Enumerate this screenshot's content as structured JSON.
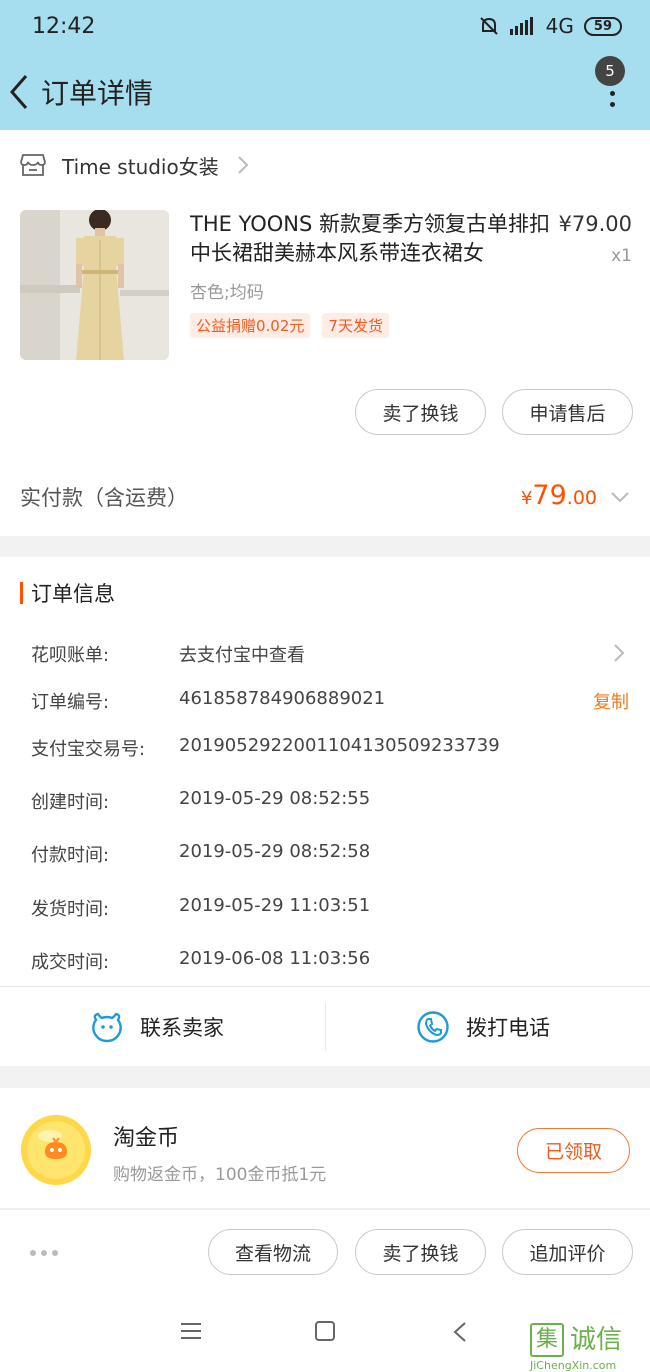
{
  "status_bar": {
    "time": "12:42",
    "network": "4G",
    "battery": "59"
  },
  "header": {
    "title": "订单详情",
    "badge_count": "5"
  },
  "shop": {
    "name": "Time studio女装"
  },
  "product": {
    "title": "THE YOONS 新款夏季方领复古单排扣中长裙甜美赫本风系带连衣裙女",
    "price": "¥79.00",
    "quantity": "x1",
    "sku": "杏色;均码",
    "tags": [
      "公益捐赠0.02元",
      "7天发货"
    ],
    "buttons": {
      "resell": "卖了换钱",
      "after_sale": "申请售后"
    }
  },
  "total": {
    "label": "实付款（含运费）",
    "currency": "¥",
    "integer": "79",
    "decimal": ".00"
  },
  "order_info": {
    "title": "订单信息",
    "rows": [
      {
        "label": "花呗账单:",
        "value": "去支付宝中查看"
      },
      {
        "label": "订单编号:",
        "value": "461858784906889021",
        "action": "复制"
      },
      {
        "label": "支付宝交易号:",
        "value": "2019052922001104130509233739"
      },
      {
        "label": "创建时间:",
        "value": "2019-05-29 08:52:55"
      },
      {
        "label": "付款时间:",
        "value": "2019-05-29 08:52:58"
      },
      {
        "label": "发货时间:",
        "value": "2019-05-29 11:03:51"
      },
      {
        "label": "成交时间:",
        "value": "2019-06-08 11:03:56"
      }
    ],
    "contact_seller": "联系卖家",
    "call_phone": "拨打电话"
  },
  "coin": {
    "title": "淘金币",
    "subtitle": "购物返金币，100金币抵1元",
    "button": "已领取"
  },
  "actions": {
    "logistics": "查看物流",
    "resell": "卖了换钱",
    "add_review": "追加评价"
  },
  "watermark": {
    "text": "诚信",
    "box_char": "集",
    "url": "JiChengXin.com"
  },
  "colors": {
    "header_bg": "#a6def0",
    "accent": "#ff5000",
    "link": "#f27a1b"
  }
}
